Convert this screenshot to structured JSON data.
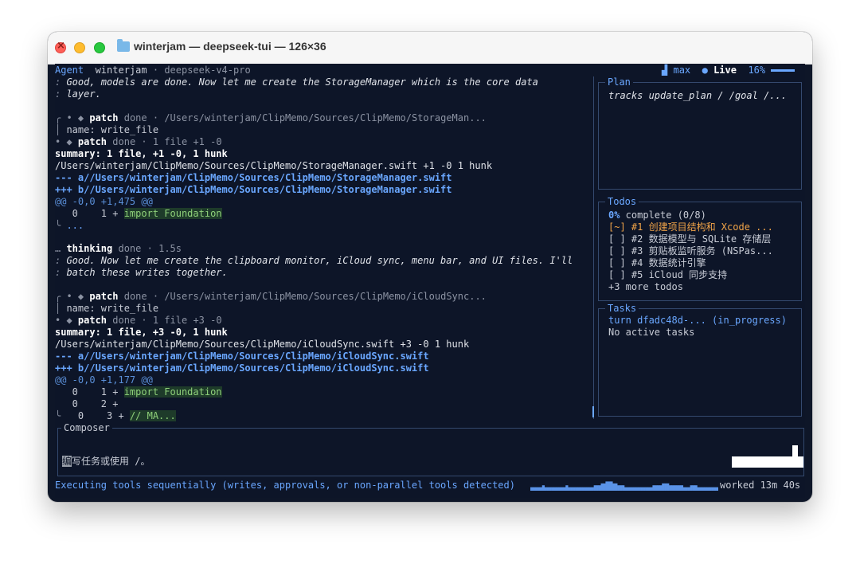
{
  "window": {
    "title": "winterjam — deepseek-tui — 126×36"
  },
  "header": {
    "agent": "Agent",
    "project": "winterjam",
    "sep": "·",
    "model": "deepseek-v4-pro",
    "mode": "max",
    "live": "Live",
    "usage": "16%"
  },
  "log": {
    "msg1a": "Good, models are done. Now let me create the StorageManager which is the core data",
    "msg1b": "layer.",
    "p1": {
      "patch": "patch",
      "status": "done",
      "path": "/Users/winterjam/ClipMemo/Sources/ClipMemo/StorageMan...",
      "name": "name: write_file",
      "summary_short": "1 file +1 -0",
      "summary": "summary: 1 file, +1 -0, 1 hunk",
      "fileline": "/Users/winterjam/ClipMemo/Sources/ClipMemo/StorageManager.swift +1 -0 1 hunk",
      "minus": "--- a//Users/winterjam/ClipMemo/Sources/ClipMemo/StorageManager.swift",
      "plus": "+++ b//Users/winterjam/ClipMemo/Sources/ClipMemo/StorageManager.swift",
      "hunk": "@@ -0,0 +1,475 @@",
      "row1_prefix": "   0    1 + ",
      "row1_code": "import Foundation",
      "more": "..."
    },
    "thinking": {
      "label": "thinking",
      "status": "done",
      "time": "1.5s",
      "l1": "Good. Now let me create the clipboard monitor, iCloud sync, menu bar, and UI files. I'll",
      "l2": "batch these writes together."
    },
    "p2": {
      "patch": "patch",
      "status": "done",
      "path": "/Users/winterjam/ClipMemo/Sources/ClipMemo/iCloudSync...",
      "name": "name: write_file",
      "summary_short": "1 file +3 -0",
      "summary": "summary: 1 file, +3 -0, 1 hunk",
      "fileline": "/Users/winterjam/ClipMemo/Sources/ClipMemo/iCloudSync.swift +3 -0 1 hunk",
      "minus": "--- a//Users/winterjam/ClipMemo/Sources/ClipMemo/iCloudSync.swift",
      "plus": "+++ b//Users/winterjam/ClipMemo/Sources/ClipMemo/iCloudSync.swift",
      "hunk": "@@ -0,0 +1,177 @@",
      "row1_prefix": "   0    1 + ",
      "row1_code": "import Foundation",
      "row2": "   0    2 +",
      "row3_prefix": "   0    3 + ",
      "row3_code": "// MA..."
    }
  },
  "plan": {
    "title": "Plan",
    "text": "tracks update_plan / /goal /..."
  },
  "todos": {
    "title": "Todos",
    "pct": "0%",
    "complete": " complete (0/8)",
    "items": [
      "[~] #1 创建项目结构和 Xcode ...",
      "[ ] #2 数据模型与 SQLite 存储层",
      "[ ] #3 剪贴板监听服务 (NSPas...",
      "[ ] #4 数据统计引擎",
      "[ ] #5 iCloud 同步支持"
    ],
    "more": "+3 more todos"
  },
  "tasks": {
    "title": "Tasks",
    "turn": "turn dfadc48d-... (in_progress)",
    "none": "No active tasks"
  },
  "composer": {
    "title": "Composer",
    "cursor_char": "编",
    "placeholder": "写任务或使用 /。"
  },
  "status": {
    "text": "Executing tools sequentially (writes, approvals, or non-parallel tools detected)",
    "worked": "worked 13m 40s"
  },
  "activity": {
    "levels": [
      1,
      1,
      1,
      1,
      1,
      2,
      1,
      1,
      1,
      1,
      1,
      1,
      1,
      1,
      1,
      2,
      1,
      1,
      1,
      1,
      1,
      1,
      1,
      1,
      1,
      1,
      1,
      2,
      2,
      2,
      3,
      3,
      4,
      4,
      4,
      3,
      3,
      2,
      2,
      2,
      1,
      1,
      1,
      1,
      1,
      1,
      1,
      1,
      1,
      1,
      1,
      1,
      2,
      2,
      2,
      2,
      3,
      3,
      3,
      2,
      2,
      2,
      2,
      2,
      2,
      1,
      1,
      1,
      2,
      2,
      2,
      1,
      1,
      1,
      1,
      1,
      1,
      1,
      1,
      1
    ],
    "color": "#5a93e8"
  },
  "colors": {
    "bg": "#0d1528",
    "accent": "#6aa7ff",
    "border": "#34496e",
    "todo_active": "#f0a348"
  }
}
